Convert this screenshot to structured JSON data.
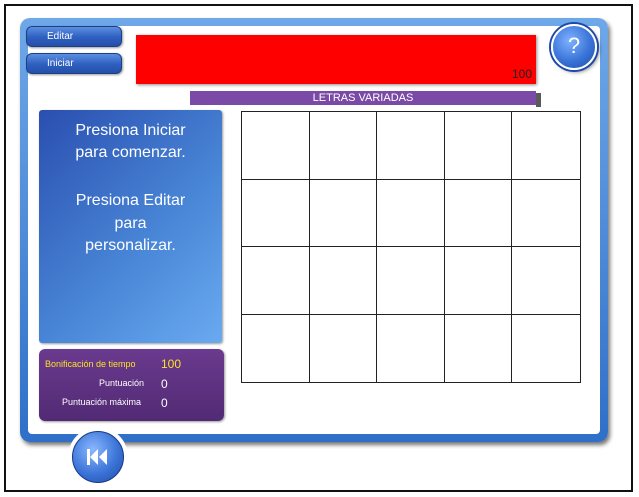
{
  "buttons": {
    "edit_label": "Editar",
    "start_label": "Iniciar",
    "help_label": "?"
  },
  "game": {
    "title": "LETRAS VARIADAS",
    "timer_value": "100"
  },
  "instructions": {
    "line1": "Presiona Iniciar",
    "line2": "para comenzar.",
    "line3": "Presiona Editar",
    "line4": "para",
    "line5": "personalizar."
  },
  "score": {
    "time_bonus_label": "Bonificación de tiempo",
    "time_bonus_value": "100",
    "score_label": "Puntuación",
    "score_value": "0",
    "max_score_label": "Puntuación máxima",
    "max_score_value": "0"
  },
  "board": {
    "rows": 4,
    "columns": 5
  },
  "icons": {
    "help": "question-mark-icon",
    "rewind": "rewind-icon"
  },
  "colors": {
    "timer_bar": "#ff0000",
    "title_bar": "#7a4aa6",
    "frame": "#2f6fc8",
    "score_panel": "#5a2d7e",
    "bonus_text": "#ffe028"
  }
}
